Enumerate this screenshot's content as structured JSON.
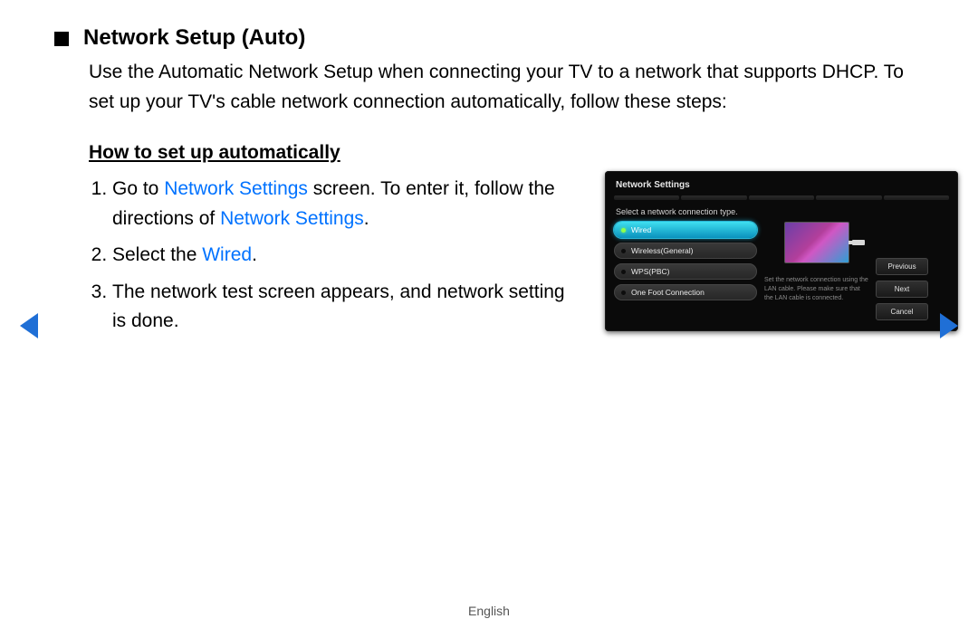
{
  "title": "Network Setup (Auto)",
  "intro": "Use the Automatic Network Setup when connecting your TV to a network that supports DHCP. To set up your TV's cable network connection automatically, follow these steps:",
  "subheading": "How to set up automatically",
  "steps": {
    "1": {
      "prefix": "Go to ",
      "link1": "Network Settings",
      "mid": " screen. To enter it, follow the directions of ",
      "link2": "Network Settings",
      "suffix": "."
    },
    "2": {
      "prefix": "Select the ",
      "link": "Wired",
      "suffix": "."
    },
    "3": "The network test screen appears, and network setting is done."
  },
  "dialog": {
    "title": "Network Settings",
    "prompt": "Select a network connection type.",
    "items": [
      "Wired",
      "Wireless(General)",
      "WPS(PBC)",
      "One Foot Connection"
    ],
    "selected_index": 0,
    "help": "Set the network connection using the LAN cable. Please make sure that the LAN cable is connected.",
    "buttons": [
      "Previous",
      "Next",
      "Cancel"
    ]
  },
  "footer": "English"
}
